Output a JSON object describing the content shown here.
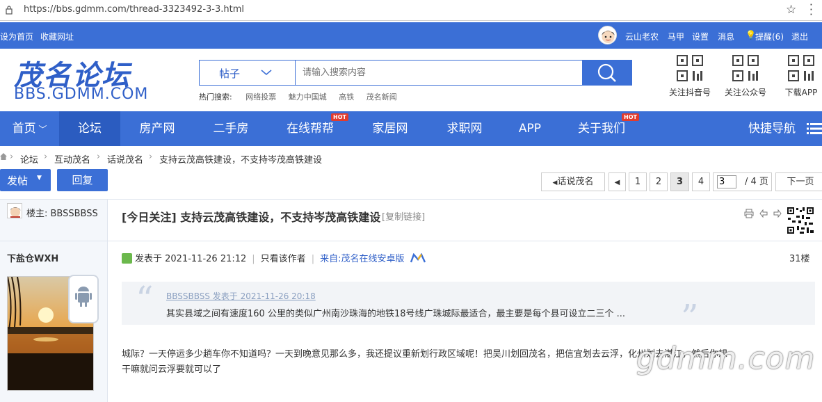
{
  "browser": {
    "url": "https://bbs.gdmm.com/thread-3323492-3-3.html"
  },
  "topbar": {
    "set_home": "设为首页",
    "bookmark": "收藏网址",
    "username": "云山老农",
    "links": [
      "马甲",
      "设置",
      "消息"
    ],
    "reminder": "提醒(6)",
    "logout": "退出"
  },
  "header": {
    "logo_cn": "茂名论坛",
    "logo_en": "BBS.GDMM.COM",
    "search_type": "帖子",
    "search_placeholder": "请输入搜索内容",
    "hot_search_label": "热门搜索:",
    "hot_search": [
      "网络投票",
      "魅力中国城",
      "高铁",
      "茂名新闻"
    ],
    "qr_items": [
      "关注抖音号",
      "关注公众号",
      "下载APP"
    ]
  },
  "nav": {
    "items": [
      {
        "label": "首页",
        "dropdown": true
      },
      {
        "label": "论坛",
        "active": true
      },
      {
        "label": "房产网"
      },
      {
        "label": "二手房"
      },
      {
        "label": "在线帮帮",
        "hot": "HOT"
      },
      {
        "label": "家居网"
      },
      {
        "label": "求职网"
      },
      {
        "label": "APP"
      },
      {
        "label": "关于我们",
        "hot": "HOT"
      }
    ],
    "quick_nav": "快捷导航"
  },
  "breadcrumb": [
    "论坛",
    "互动茂名",
    "话说茂名",
    "支持云茂高铁建设，不支持岑茂高铁建设"
  ],
  "actions": {
    "post": "发帖",
    "reply": "回复"
  },
  "pager": {
    "back": "话说茂名",
    "pages": [
      "1",
      "2",
      "3",
      "4"
    ],
    "current": "3",
    "input_value": "3",
    "total": "/ 4 页",
    "next": "下一页"
  },
  "thread": {
    "op_label": "楼主: BBSSBBSS",
    "title": "[今日关注] 支持云茂高铁建设，不支持岑茂高铁建设",
    "copy_link": "[复制链接]"
  },
  "post": {
    "author": "下盐仓WXH",
    "posted": "发表于 2021-11-26 21:12",
    "only_author": "只看该作者",
    "from": "来自:茂名在线安卓版",
    "floor": "31楼",
    "quote_author": "BBSSBBSS 发表于 2021-11-26 20:18",
    "quote_text": "其实县域之间有速度160 公里的类似广州南沙珠海的地铁18号线广珠城际最适合，最主要是每个县可设立二三个 ...",
    "body_line1": "城际？一天停运多少趟车你不知道吗？一天到晚意见那么多，我还提议重新划行政区域呢！把吴川划回茂名，把信宜划去云浮，化州划去湛江，然后你想",
    "body_line2": "干嘛就问云浮要就可以了",
    "watermark": "gdmm.com"
  },
  "colors": {
    "brand": "#3b6fd6",
    "nav_active": "#2b5cc0",
    "hot": "#e23c2e"
  }
}
